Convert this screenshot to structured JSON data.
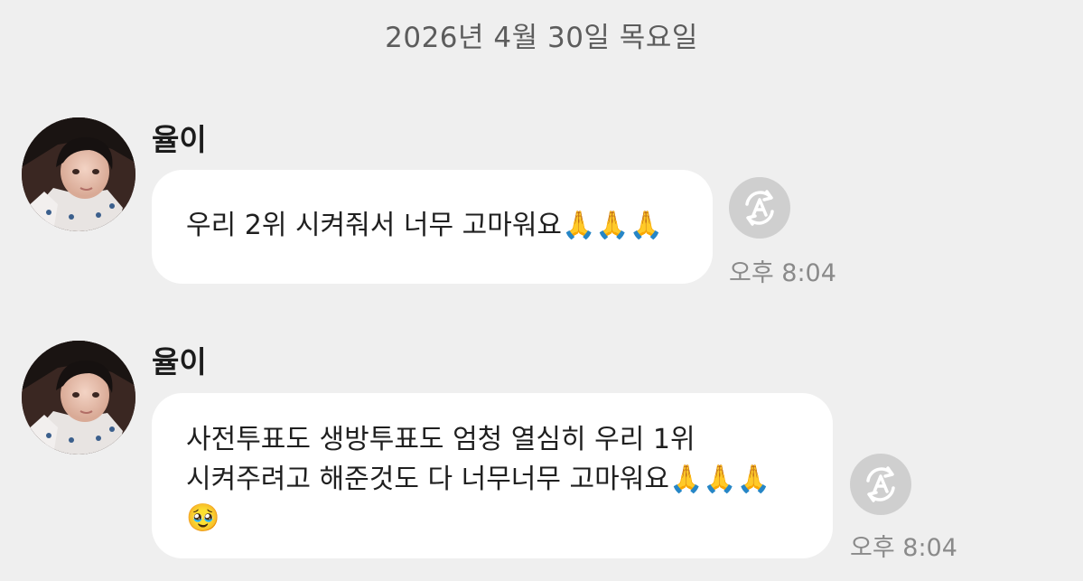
{
  "date_divider": "2026년 4월 30일 목요일",
  "messages": [
    {
      "sender": "율이",
      "lines": [
        "우리 2위 시켜줘서 너무 고마워요🙏🙏🙏"
      ],
      "time": "오후 8:04",
      "translate_icon": "translate-a-icon",
      "avatar_icon": "profile-photo"
    },
    {
      "sender": "율이",
      "lines": [
        "사전투표도 생방투표도 엄청 열심히 우리 1위",
        "시켜주려고 해준것도 다 너무너무 고마워요🙏🙏🙏",
        "🥹"
      ],
      "time": "오후 8:04",
      "translate_icon": "translate-a-icon",
      "avatar_icon": "profile-photo"
    }
  ],
  "colors": {
    "background": "#efefef",
    "bubble": "#ffffff",
    "time_text": "#8a8a8a",
    "translate_button": "#cfcfcf"
  }
}
